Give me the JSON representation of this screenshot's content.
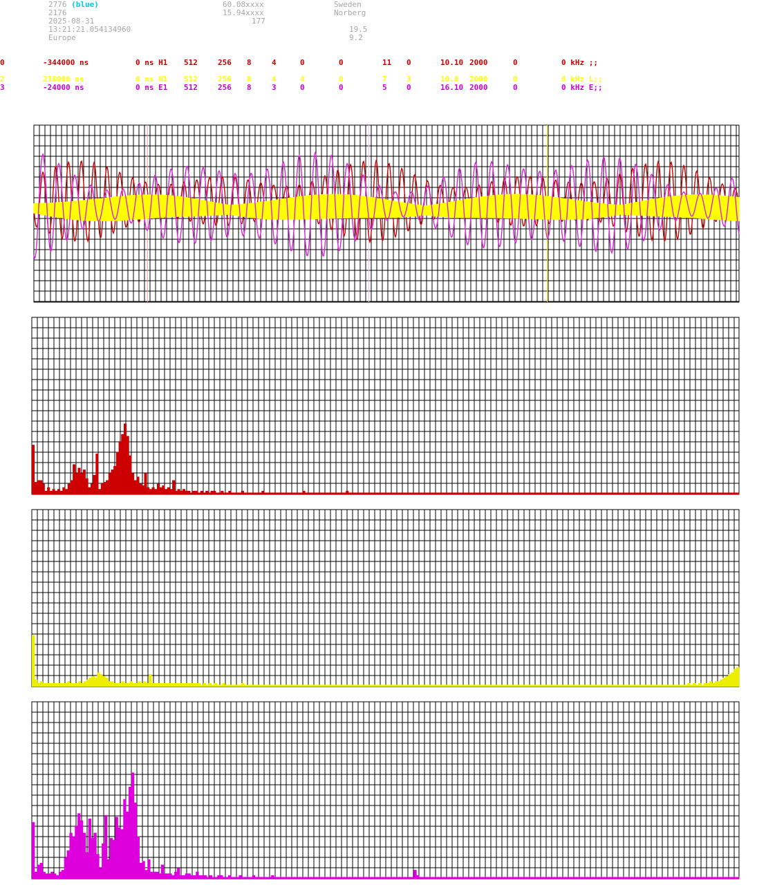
{
  "header": {
    "left": [
      "2776",
      "2176",
      "2025-08-31",
      "13:21:21.054134960",
      "Europe"
    ],
    "left_suffix": "(blue)",
    "mid": [
      "60.08xxxx",
      "15.94xxxx",
      "177"
    ],
    "right": [
      "Sweden",
      "Norberg"
    ],
    "right2": [
      "19.5",
      "9.2"
    ]
  },
  "channels": [
    {
      "color": "#cc0000",
      "cols": [
        "0",
        "-344000 ns",
        "0 ns H1",
        "512",
        "256",
        "8",
        "4",
        "0",
        "0",
        "11",
        "0",
        "10.10",
        "2000",
        "0",
        "0 kHz ;;"
      ]
    },
    {
      "color": "#ffff00",
      "cols": [
        "2",
        "238000 ns",
        "0 ns H1",
        "512",
        "256",
        "8",
        "4",
        "4",
        "0",
        "7",
        "3",
        "10.8",
        "2000",
        "0",
        "0 kHz L;;"
      ]
    },
    {
      "color": "#cc00cc",
      "cols": [
        "3",
        "-24000 ns",
        "0 ns E1",
        "512",
        "256",
        "8",
        "3",
        "0",
        "0",
        "5",
        "0",
        "16.10",
        "2000",
        "0",
        "0 kHz E;;"
      ]
    }
  ],
  "colors": {
    "ch1": "#cc0000",
    "ch2": "#ffff00",
    "ch3": "#dd22dd",
    "grid": "#000000"
  },
  "chart_data": [
    {
      "type": "line",
      "series": [
        {
          "color": "#cc0000",
          "kind": "sine",
          "cycles": 55,
          "amp": 0.23,
          "offset": 0.43,
          "phase": 0.3
        },
        {
          "color": "#ffff00",
          "kind": "band",
          "amp": 0.07,
          "offset": 0.47
        },
        {
          "color": "#dd22dd",
          "kind": "sine",
          "cycles": 44,
          "amp": 0.32,
          "offset": 0.45,
          "phase": 1.2
        }
      ],
      "markers": [
        {
          "x": 0.161,
          "color": "#ff9999"
        },
        {
          "x": 0.475,
          "color": "#ffbbff"
        },
        {
          "x": 0.728,
          "color": "#ffff00"
        }
      ]
    },
    {
      "type": "bar",
      "color": "#cc0000",
      "values": [
        0.28,
        0.07,
        0.08,
        0.08,
        0.06,
        0.02,
        0.04,
        0.02,
        0.03,
        0.02,
        0.03,
        0.02,
        0.04,
        0.03,
        0.06,
        0.08,
        0.17,
        0.12,
        0.15,
        0.12,
        0.14,
        0.09,
        0.04,
        0.06,
        0.11,
        0.23,
        0.03,
        0.06,
        0.07,
        0.08,
        0.12,
        0.14,
        0.16,
        0.24,
        0.3,
        0.34,
        0.4,
        0.33,
        0.22,
        0.12,
        0.08,
        0.1,
        0.06,
        0.05,
        0.12,
        0.04,
        0.03,
        0.04,
        0.03,
        0.06,
        0.04,
        0.05,
        0.03,
        0.04,
        0.03,
        0.08,
        0.02,
        0.03,
        0.02,
        0.03,
        0.02,
        0.02,
        0.01,
        0.02,
        0.02,
        0.01,
        0.02,
        0.01,
        0.02,
        0.01,
        0.02,
        0.02,
        0.01,
        0.01,
        0.02,
        0.01,
        0.01,
        0.02,
        0.01,
        0.01,
        0.01,
        0.01,
        0.02,
        0.01,
        0.01,
        0.01,
        0.01,
        0.01,
        0.01,
        0.01,
        0.02,
        0.01,
        0.01,
        0.01,
        0.01,
        0.01,
        0.01,
        0.01,
        0.01,
        0.01,
        0.01,
        0.01,
        0.01,
        0.01,
        0.01,
        0.01,
        0.02,
        0.01,
        0.01,
        0.01,
        0.01,
        0.01,
        0.01,
        0.01,
        0.01,
        0.01,
        0.01,
        0.01,
        0.01,
        0.01,
        0.01,
        0.01,
        0.01,
        0.02,
        0.01,
        0.01,
        0.01,
        0.01,
        0.01,
        0.01,
        0.01,
        0.01,
        0.01,
        0.01,
        0.01,
        0.01,
        0.01,
        0.01,
        0.01,
        0.01,
        0.01,
        0.01,
        0.01,
        0.01,
        0.01,
        0.01,
        0.01,
        0.01,
        0.01,
        0.01,
        0.01,
        0.01,
        0.01,
        0.01,
        0.01,
        0.01,
        0.01,
        0.01,
        0.01,
        0.01,
        0.01,
        0.01,
        0.01,
        0.01,
        0.01,
        0.01,
        0.01,
        0.01,
        0.01,
        0.01,
        0.01,
        0.01,
        0.01,
        0.01,
        0.01,
        0.01,
        0.01,
        0.01,
        0.01,
        0.01,
        0.01,
        0.01,
        0.01,
        0.01,
        0.01,
        0.01,
        0.01,
        0.01,
        0.01,
        0.01,
        0.01,
        0.01,
        0.01,
        0.01,
        0.01,
        0.01,
        0.01,
        0.01,
        0.01,
        0.01,
        0.01,
        0.01,
        0.01,
        0.01,
        0.01,
        0.01,
        0.01,
        0.01,
        0.01,
        0.01,
        0.01,
        0.01,
        0.01,
        0.01,
        0.01,
        0.01,
        0.01,
        0.01,
        0.01,
        0.01,
        0.01,
        0.01,
        0.01,
        0.01,
        0.01,
        0.01,
        0.01,
        0.01,
        0.01,
        0.01,
        0.01,
        0.01,
        0.01,
        0.01,
        0.01,
        0.01,
        0.01,
        0.01,
        0.01,
        0.01,
        0.01,
        0.01,
        0.01,
        0.01,
        0.01,
        0.01,
        0.01,
        0.01,
        0.01,
        0.01,
        0.01,
        0.01,
        0.01,
        0.01,
        0.01,
        0.01,
        0.01,
        0.01,
        0.01,
        0.01,
        0.01,
        0.01,
        0.01,
        0.01,
        0.01,
        0.01,
        0.01,
        0.01,
        0.01,
        0.01,
        0.01,
        0.01,
        0.01,
        0.01,
        0.01,
        0.01,
        0.01
      ]
    },
    {
      "type": "bar",
      "color": "#eeee00",
      "values": [
        0.29,
        0.04,
        0.02,
        0.03,
        0.02,
        0.02,
        0.02,
        0.02,
        0.02,
        0.02,
        0.02,
        0.02,
        0.02,
        0.03,
        0.02,
        0.02,
        0.02,
        0.03,
        0.02,
        0.03,
        0.04,
        0.05,
        0.06,
        0.05,
        0.08,
        0.07,
        0.06,
        0.05,
        0.03,
        0.03,
        0.02,
        0.02,
        0.02,
        0.03,
        0.02,
        0.02,
        0.03,
        0.02,
        0.02,
        0.03,
        0.02,
        0.03,
        0.02,
        0.07,
        0.02,
        0.02,
        0.02,
        0.02,
        0.02,
        0.02,
        0.02,
        0.02,
        0.02,
        0.02,
        0.02,
        0.02,
        0.02,
        0.02,
        0.02,
        0.02,
        0.02,
        0.02,
        0.01,
        0.02,
        0.01,
        0.02,
        0.01,
        0.02,
        0.01,
        0.01,
        0.02,
        0.01,
        0.01,
        0.01,
        0.01,
        0.01,
        0.01,
        0.02,
        0.01,
        0.01,
        0.01,
        0.01,
        0.01,
        0.01,
        0.01,
        0.01,
        0.01,
        0.01,
        0.01,
        0.01,
        0.01,
        0.01,
        0.01,
        0.01,
        0.01,
        0.01,
        0.01,
        0.01,
        0.01,
        0.01,
        0.01,
        0.01,
        0.01,
        0.01,
        0.01,
        0.01,
        0.01,
        0.01,
        0.01,
        0.01,
        0.01,
        0.01,
        0.01,
        0.01,
        0.01,
        0.01,
        0.01,
        0.01,
        0.01,
        0.01,
        0.01,
        0.01,
        0.01,
        0.01,
        0.01,
        0.01,
        0.01,
        0.01,
        0.01,
        0.01,
        0.01,
        0.01,
        0.01,
        0.01,
        0.01,
        0.01,
        0.01,
        0.01,
        0.01,
        0.01,
        0.01,
        0.01,
        0.01,
        0.01,
        0.01,
        0.01,
        0.01,
        0.01,
        0.01,
        0.01,
        0.01,
        0.01,
        0.01,
        0.01,
        0.01,
        0.01,
        0.01,
        0.01,
        0.01,
        0.01,
        0.01,
        0.01,
        0.01,
        0.01,
        0.01,
        0.01,
        0.01,
        0.01,
        0.01,
        0.01,
        0.01,
        0.01,
        0.01,
        0.01,
        0.01,
        0.01,
        0.01,
        0.01,
        0.01,
        0.01,
        0.01,
        0.01,
        0.01,
        0.01,
        0.01,
        0.01,
        0.01,
        0.01,
        0.01,
        0.01,
        0.01,
        0.01,
        0.01,
        0.01,
        0.01,
        0.01,
        0.01,
        0.01,
        0.01,
        0.01,
        0.01,
        0.01,
        0.01,
        0.01,
        0.01,
        0.01,
        0.01,
        0.01,
        0.01,
        0.01,
        0.01,
        0.01,
        0.01,
        0.01,
        0.01,
        0.01,
        0.01,
        0.01,
        0.01,
        0.01,
        0.01,
        0.01,
        0.01,
        0.01,
        0.01,
        0.01,
        0.01,
        0.01,
        0.01,
        0.01,
        0.01,
        0.01,
        0.01,
        0.01,
        0.01,
        0.01,
        0.01,
        0.01,
        0.01,
        0.01,
        0.01,
        0.02,
        0.01,
        0.02,
        0.01,
        0.02,
        0.01,
        0.02,
        0.02,
        0.03,
        0.02,
        0.03,
        0.03,
        0.04,
        0.05,
        0.06,
        0.07,
        0.08,
        0.1,
        0.11
      ]
    },
    {
      "type": "bar",
      "color": "#dd00dd",
      "values": [
        0.32,
        0.04,
        0.08,
        0.09,
        0.04,
        0.03,
        0.03,
        0.04,
        0.03,
        0.02,
        0.04,
        0.05,
        0.12,
        0.16,
        0.26,
        0.24,
        0.3,
        0.37,
        0.33,
        0.26,
        0.15,
        0.34,
        0.23,
        0.26,
        0.14,
        0.06,
        0.2,
        0.36,
        0.11,
        0.23,
        0.22,
        0.35,
        0.29,
        0.28,
        0.45,
        0.38,
        0.52,
        0.6,
        0.43,
        0.24,
        0.09,
        0.1,
        0.05,
        0.11,
        0.04,
        0.04,
        0.04,
        0.03,
        0.08,
        0.03,
        0.03,
        0.03,
        0.02,
        0.04,
        0.06,
        0.02,
        0.02,
        0.03,
        0.03,
        0.02,
        0.02,
        0.04,
        0.02,
        0.02,
        0.02,
        0.01,
        0.02,
        0.01,
        0.01,
        0.02,
        0.02,
        0.01,
        0.01,
        0.02,
        0.01,
        0.01,
        0.01,
        0.02,
        0.01,
        0.01,
        0.01,
        0.01,
        0.02,
        0.01,
        0.01,
        0.01,
        0.01,
        0.01,
        0.01,
        0.02,
        0.01,
        0.01,
        0.01,
        0.01,
        0.01,
        0.01,
        0.01,
        0.01,
        0.01,
        0.01,
        0.01,
        0.01,
        0.01,
        0.01,
        0.01,
        0.01,
        0.01,
        0.01,
        0.01,
        0.01,
        0.01,
        0.01,
        0.01,
        0.01,
        0.01,
        0.01,
        0.01,
        0.01,
        0.01,
        0.01,
        0.01,
        0.01,
        0.01,
        0.01,
        0.01,
        0.01,
        0.01,
        0.01,
        0.01,
        0.01,
        0.01,
        0.01,
        0.01,
        0.01,
        0.01,
        0.01,
        0.01,
        0.01,
        0.01,
        0.01,
        0.01,
        0.01,
        0.05,
        0.02,
        0.01,
        0.01,
        0.01,
        0.01,
        0.01,
        0.01,
        0.01,
        0.01,
        0.01,
        0.01,
        0.01,
        0.01,
        0.01,
        0.01,
        0.01,
        0.01,
        0.01,
        0.01,
        0.01,
        0.01,
        0.01,
        0.01,
        0.01,
        0.01,
        0.01,
        0.01,
        0.01,
        0.01,
        0.01,
        0.01,
        0.01,
        0.01,
        0.01,
        0.01,
        0.01,
        0.01,
        0.01,
        0.01,
        0.01,
        0.01,
        0.01,
        0.01,
        0.01,
        0.01,
        0.01,
        0.01,
        0.01,
        0.01,
        0.01,
        0.01,
        0.01,
        0.01,
        0.01,
        0.01,
        0.01,
        0.01,
        0.01,
        0.01,
        0.01,
        0.01,
        0.01,
        0.01,
        0.01,
        0.01,
        0.01,
        0.01,
        0.01,
        0.01,
        0.01,
        0.01,
        0.01,
        0.01,
        0.01,
        0.01,
        0.01,
        0.01,
        0.01,
        0.01,
        0.01,
        0.01,
        0.01,
        0.01,
        0.01,
        0.01,
        0.01,
        0.01,
        0.01,
        0.01,
        0.01,
        0.01,
        0.01,
        0.01,
        0.01,
        0.01,
        0.01,
        0.01,
        0.01,
        0.01,
        0.01,
        0.01,
        0.01,
        0.01,
        0.01,
        0.01,
        0.01,
        0.01,
        0.01,
        0.01,
        0.01,
        0.01,
        0.01,
        0.01,
        0.01,
        0.01,
        0.01,
        0.01,
        0.01,
        0.01,
        0.01
      ]
    }
  ]
}
